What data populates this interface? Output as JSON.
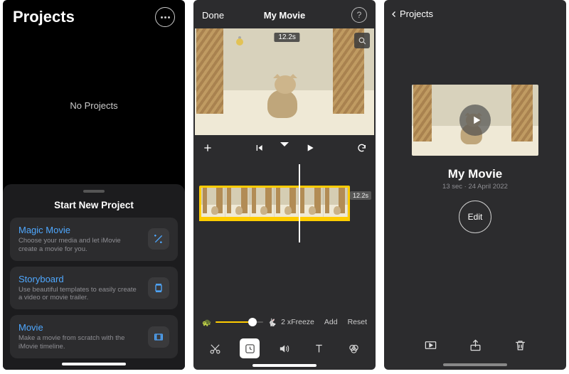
{
  "pane1": {
    "header_title": "Projects",
    "empty_state": "No Projects",
    "sheet_title": "Start New Project",
    "options": [
      {
        "title": "Magic Movie",
        "subtitle": "Choose your media and let iMovie create a movie for you."
      },
      {
        "title": "Storyboard",
        "subtitle": "Use beautiful templates to easily create a video or movie trailer."
      },
      {
        "title": "Movie",
        "subtitle": "Make a movie from scratch with the iMovie timeline."
      }
    ]
  },
  "pane2": {
    "done_label": "Done",
    "title": "My Movie",
    "clip_duration": "12.2s",
    "timeline_clip_duration": "12.2s",
    "speed_value": "2 x",
    "speed_actions": {
      "freeze": "Freeze",
      "add": "Add",
      "reset": "Reset"
    }
  },
  "pane3": {
    "back_label": "Projects",
    "title": "My Movie",
    "meta": "13 sec · 24 April 2022",
    "edit_label": "Edit"
  }
}
